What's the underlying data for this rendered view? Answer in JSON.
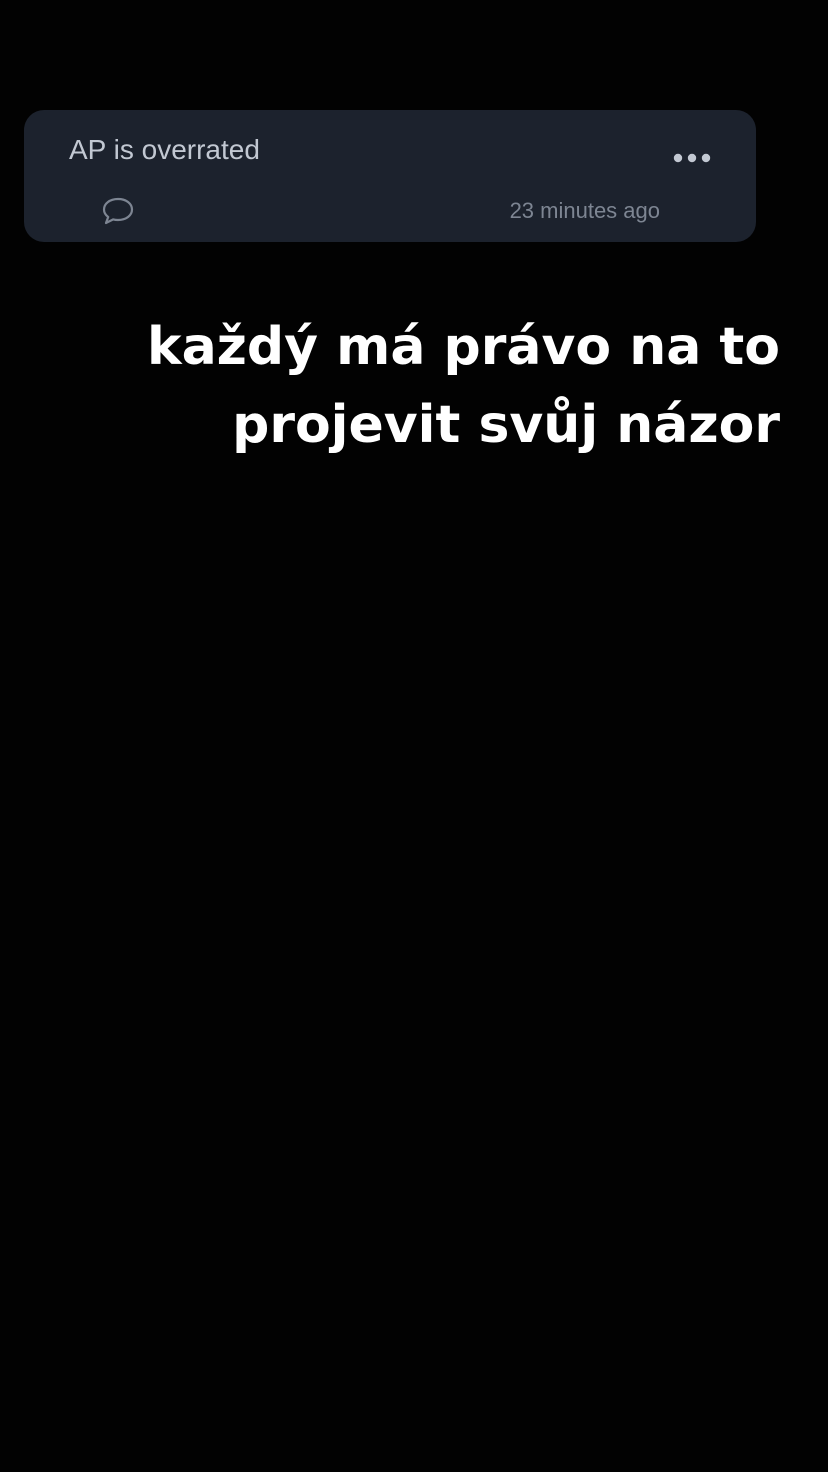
{
  "post": {
    "text": "AP is overrated",
    "timestamp": "23 minutes ago",
    "comment_icon": "speech-bubble-icon",
    "more_icon": "ellipsis-icon"
  },
  "caption": {
    "line1": "každý má právo na to",
    "line2": "projevit svůj názor"
  },
  "colors": {
    "background": "#020202",
    "card": "#1c222d",
    "post_text": "#c2c8d2",
    "muted": "#7d8592",
    "caption": "#ffffff"
  }
}
